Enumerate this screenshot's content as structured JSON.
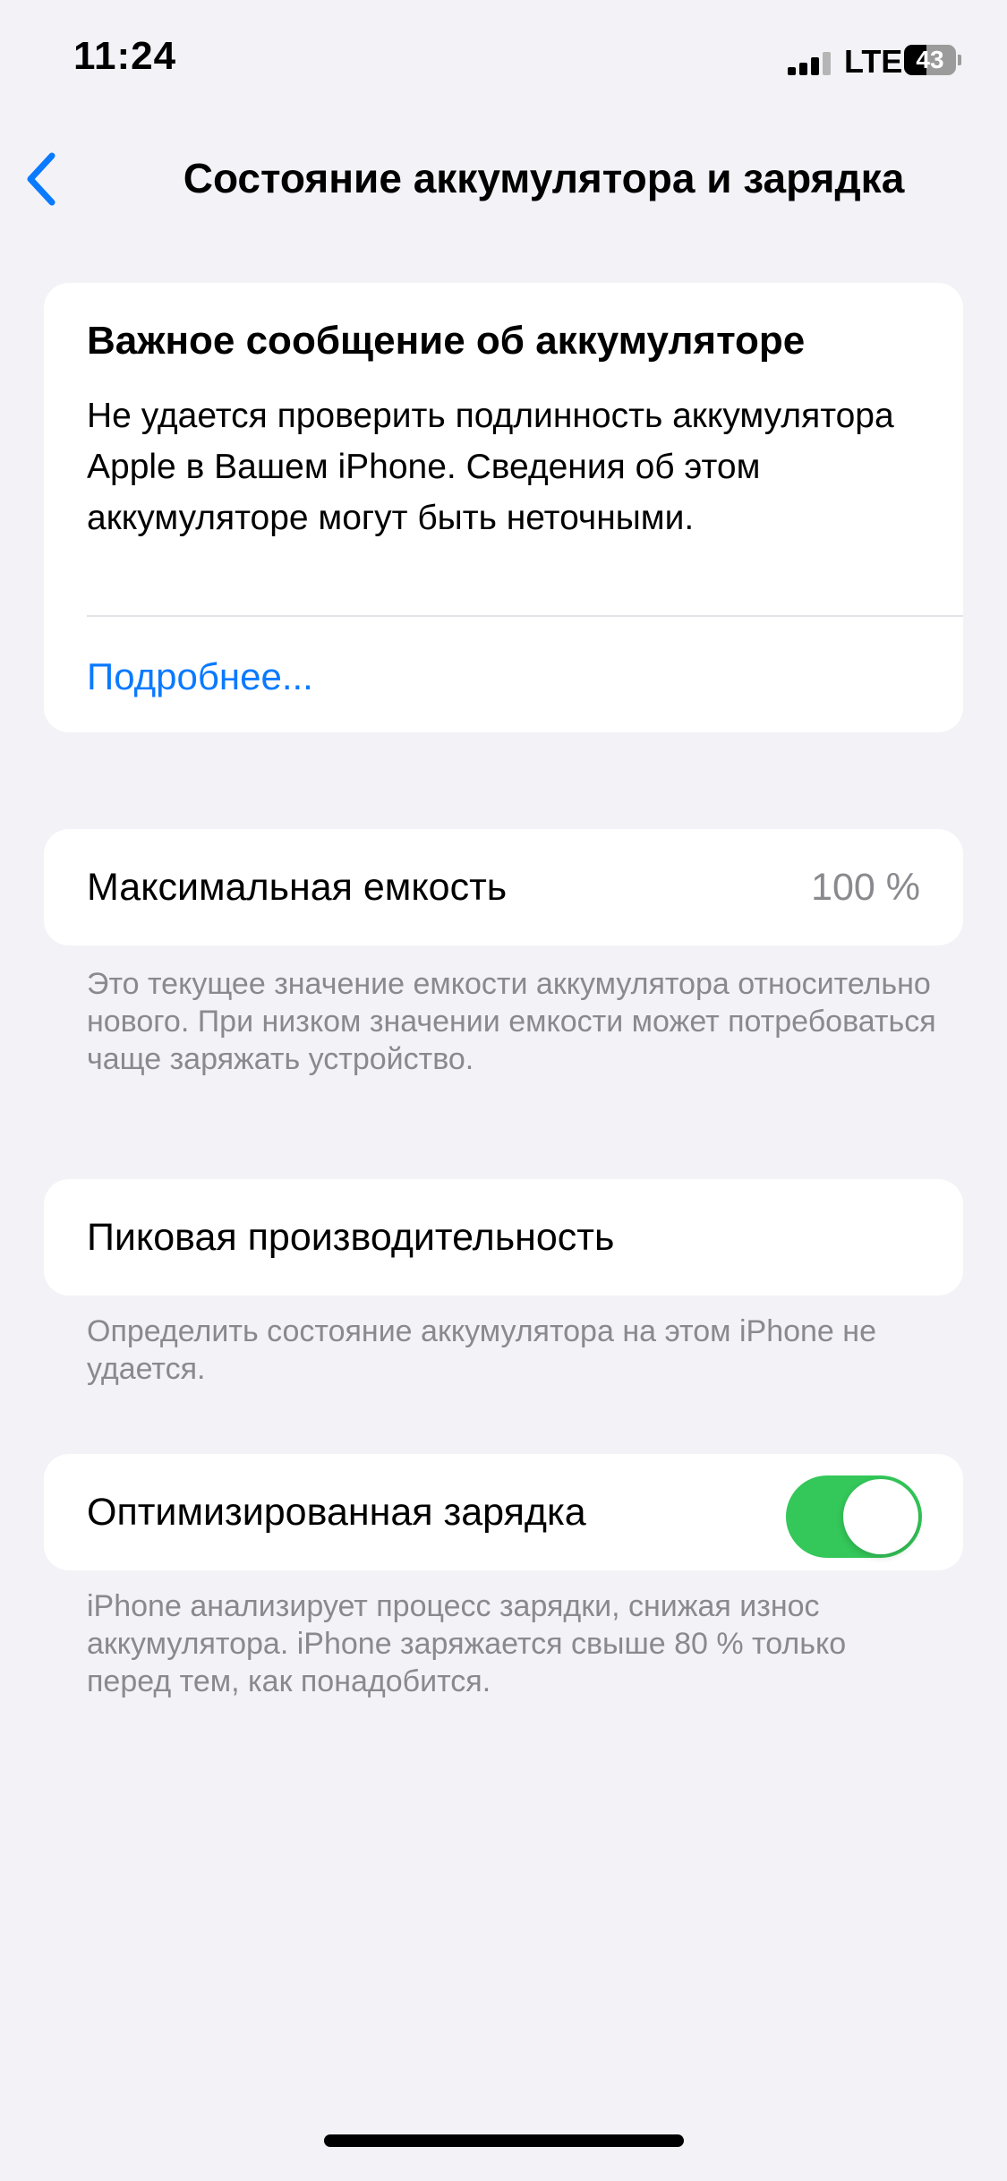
{
  "status_bar": {
    "time": "11:24",
    "network": "LTE",
    "battery_level": "43",
    "battery_fraction": 0.43
  },
  "nav": {
    "back_icon": "chevron-left-icon",
    "title": "Состояние аккумулятора и зарядка"
  },
  "alert": {
    "title": "Важное сообщение об аккумуляторе",
    "body": "Не удается проверить подлинность аккумулятора Apple в Вашем iPhone. Сведения об этом аккумуляторе могут быть неточными.",
    "link": "Подробнее..."
  },
  "max_capacity": {
    "label": "Максимальная емкость",
    "value": "100 %",
    "footnote": "Это текущее значение емкости аккумулятора относительно нового. При низком значении емкости может потребоваться чаще заряжать устройство."
  },
  "peak_performance": {
    "label": "Пиковая производительность",
    "footnote": "Определить состояние аккумулятора на этом iPhone не удается."
  },
  "optimized_charging": {
    "label": "Оптимизированная зарядка",
    "enabled": true,
    "footnote": "iPhone анализирует процесс зарядки, снижая износ аккумулятора. iPhone заряжается свыше 80 % только перед тем, как понадобится."
  },
  "colors": {
    "accent": "#0a7aff",
    "toggle_on": "#34c759",
    "background": "#f2f2f7",
    "secondary_text": "#8a8a8e"
  }
}
